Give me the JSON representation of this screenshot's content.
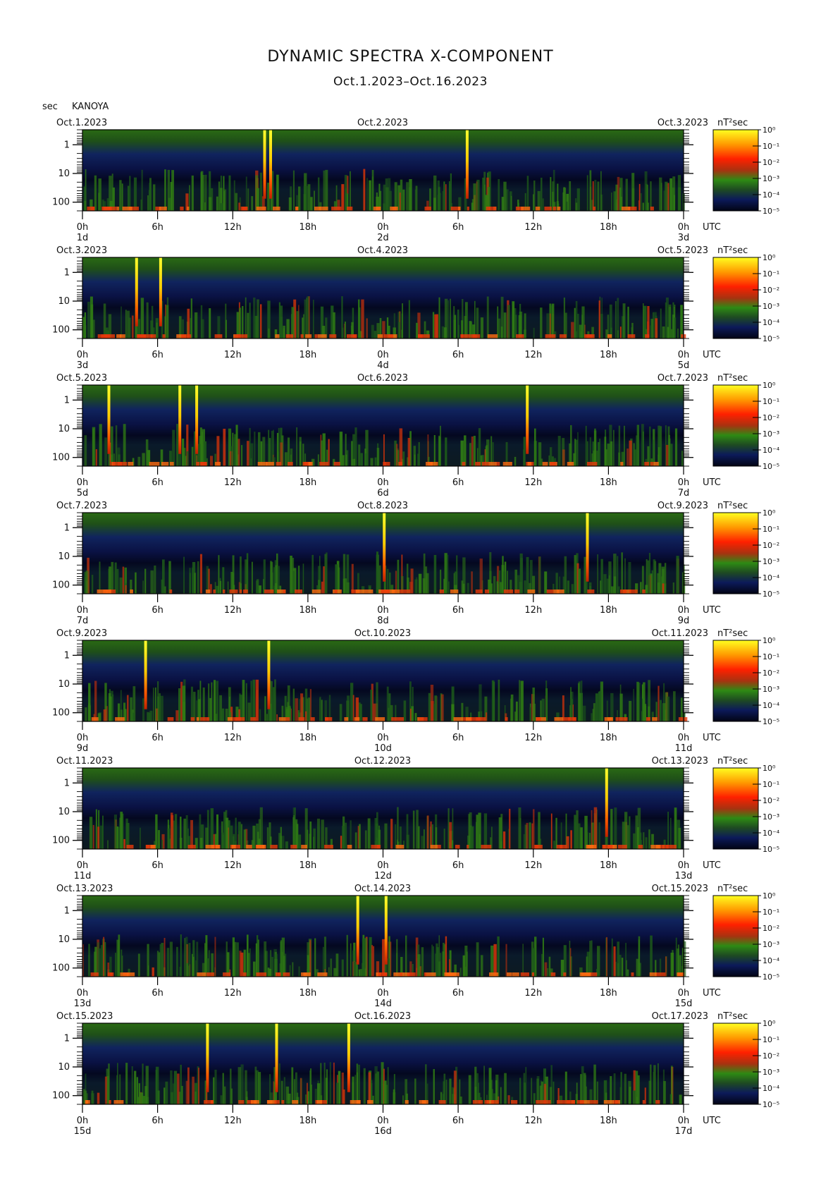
{
  "title": "DYNAMIC SPECTRA X-COMPONENT",
  "subtitle": "Oct.1.2023–Oct.16.2023",
  "y_unit": "sec",
  "station": "KANOYA",
  "colorbar_unit": "nT²sec",
  "colorbar_ticks": [
    "10⁰",
    "10⁻¹",
    "10⁻²",
    "10⁻³",
    "10⁻⁴",
    "10⁻⁵"
  ],
  "y_ticks": [
    "1",
    "10",
    "100"
  ],
  "x_ticks": [
    "0h",
    "6h",
    "12h",
    "18h",
    "0h",
    "6h",
    "12h",
    "18h",
    "0h"
  ],
  "x_unit": "UTC",
  "colors": {
    "low": "#000814",
    "blue": "#0a1a6a",
    "green": "#2f7a14",
    "red": "#e8300a",
    "yellow": "#ffee00"
  },
  "chart_data": {
    "type": "heatmap",
    "y_scale": "log",
    "ylabel": "sec",
    "color_scale": "log",
    "color_range": [
      1e-05,
      1
    ],
    "panels": [
      {
        "left": "Oct.1.2023",
        "mid": "Oct.2.2023",
        "right": "Oct.3.2023",
        "days": [
          "1d",
          "2d",
          "3d"
        ],
        "spikes": [
          0.303,
          0.313,
          0.64
        ]
      },
      {
        "left": "Oct.3.2023",
        "mid": "Oct.4.2023",
        "right": "Oct.5.2023",
        "days": [
          "3d",
          "4d",
          "5d"
        ],
        "spikes": [
          0.09,
          0.13
        ]
      },
      {
        "left": "Oct.5.2023",
        "mid": "Oct.6.2023",
        "right": "Oct.7.2023",
        "days": [
          "5d",
          "6d",
          "7d"
        ],
        "spikes": [
          0.044,
          0.162,
          0.19,
          0.74
        ]
      },
      {
        "left": "Oct.7.2023",
        "mid": "Oct.8.2023",
        "right": "Oct.9.2023",
        "days": [
          "7d",
          "8d",
          "9d"
        ],
        "spikes": [
          0.502,
          0.84
        ]
      },
      {
        "left": "Oct.9.2023",
        "mid": "Oct.10.2023",
        "right": "Oct.11.2023",
        "days": [
          "9d",
          "10d",
          "11d"
        ],
        "spikes": [
          0.105,
          0.31
        ]
      },
      {
        "left": "Oct.11.2023",
        "mid": "Oct.12.2023",
        "right": "Oct.13.2023",
        "days": [
          "11d",
          "12d",
          "13d"
        ],
        "spikes": [
          0.872
        ]
      },
      {
        "left": "Oct.13.2023",
        "mid": "Oct.14.2023",
        "right": "Oct.15.2023",
        "days": [
          "13d",
          "14d",
          "15d"
        ],
        "spikes": [
          0.458,
          0.505
        ]
      },
      {
        "left": "Oct.15.2023",
        "mid": "Oct.16.2023",
        "right": "Oct.17.2023",
        "days": [
          "15d",
          "16d",
          "17d"
        ],
        "spikes": [
          0.208,
          0.323,
          0.443
        ]
      }
    ]
  }
}
